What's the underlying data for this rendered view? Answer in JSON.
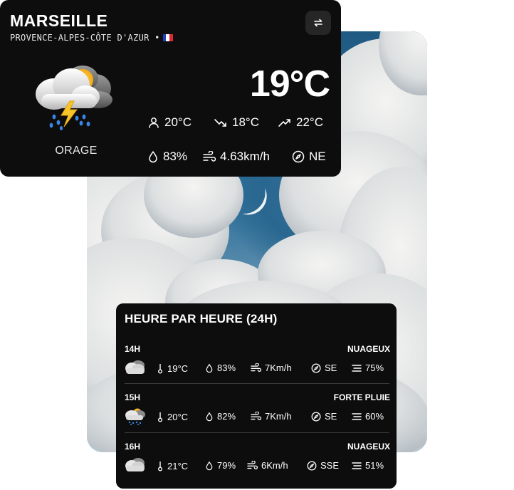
{
  "current": {
    "city": "MARSEILLE",
    "region": "PROVENCE-ALPES-CÔTE D'AZUR •",
    "flag": [
      "#1d3fbb",
      "#ffffff",
      "#e12434"
    ],
    "condition": "ORAGE",
    "condition_icon": "thunderstorm-icon",
    "temperature": "19°C",
    "feels_like": "20°C",
    "min": "18°C",
    "max": "22°C",
    "humidity": "83%",
    "wind": "4.63km/h",
    "direction": "NE"
  },
  "hourly": {
    "title": "HEURE PAR HEURE (24H)",
    "rows": [
      {
        "hour": "14H",
        "desc": "NUAGEUX",
        "icon": "cloud-icon",
        "temp": "19°C",
        "humidity": "83%",
        "wind": "7Km/h",
        "direction": "SE",
        "clouds": "75%"
      },
      {
        "hour": "15H",
        "desc": "FORTE PLUIE",
        "icon": "heavy-rain-icon",
        "temp": "20°C",
        "humidity": "82%",
        "wind": "7Km/h",
        "direction": "SE",
        "clouds": "60%"
      },
      {
        "hour": "16H",
        "desc": "NUAGEUX",
        "icon": "cloud-icon",
        "temp": "21°C",
        "humidity": "79%",
        "wind": "6Km/h",
        "direction": "SSE",
        "clouds": "51%"
      }
    ]
  }
}
